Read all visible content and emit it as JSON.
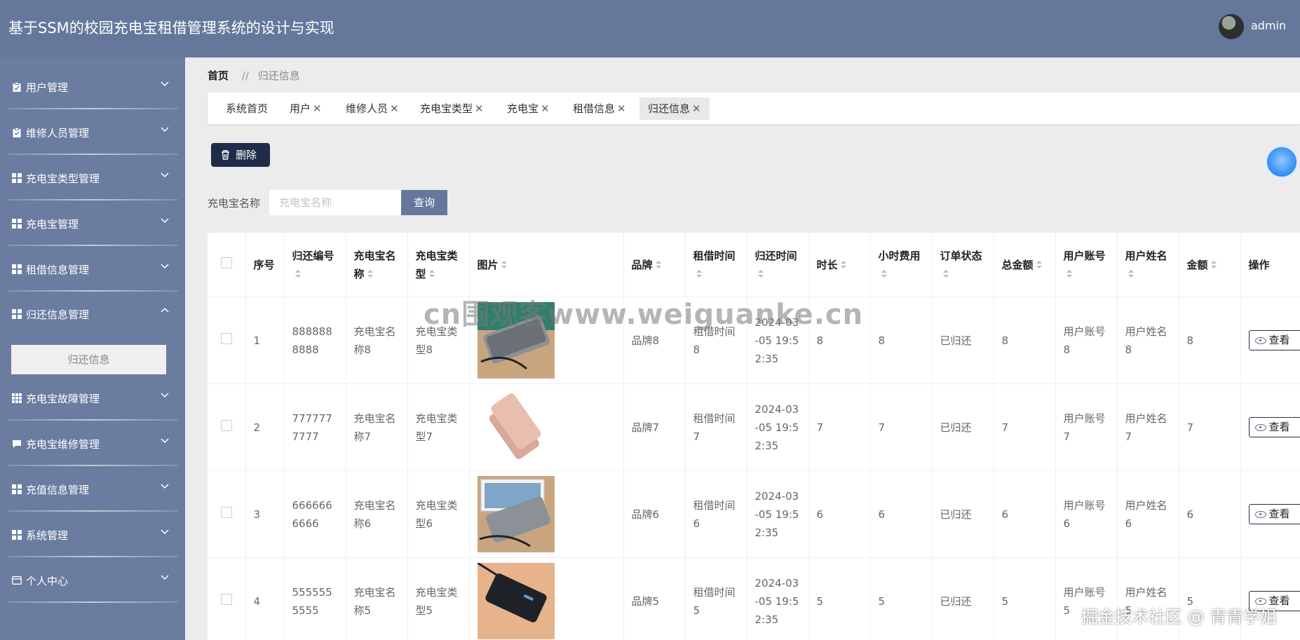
{
  "app": {
    "title": "基于SSM的校园充电宝租借管理系统的设计与实现",
    "username": "admin"
  },
  "sidebar": {
    "items": [
      {
        "label": "用户管理",
        "icon": "clipboard-icon"
      },
      {
        "label": "维修人员管理",
        "icon": "clipboard-check-icon"
      },
      {
        "label": "充电宝类型管理",
        "icon": "grid-icon"
      },
      {
        "label": "充电宝管理",
        "icon": "grid-icon"
      },
      {
        "label": "租借信息管理",
        "icon": "grid-icon"
      },
      {
        "label": "归还信息管理",
        "icon": "grid-icon"
      },
      {
        "label": "充电宝故障管理",
        "icon": "grid-9-icon"
      },
      {
        "label": "充电宝维修管理",
        "icon": "chat-icon"
      },
      {
        "label": "充值信息管理",
        "icon": "grid-icon"
      },
      {
        "label": "系统管理",
        "icon": "grid-icon"
      },
      {
        "label": "个人中心",
        "icon": "card-icon"
      }
    ],
    "sub_item": "归还信息"
  },
  "breadcrumb": {
    "home": "首页",
    "separator": "//",
    "current": "归还信息"
  },
  "tabs": [
    {
      "label": "系统首页",
      "closable": false
    },
    {
      "label": "用户",
      "closable": true
    },
    {
      "label": "维修人员",
      "closable": true
    },
    {
      "label": "充电宝类型",
      "closable": true
    },
    {
      "label": "充电宝",
      "closable": true
    },
    {
      "label": "租借信息",
      "closable": true
    },
    {
      "label": "归还信息",
      "closable": true,
      "active": true
    }
  ],
  "tab_close": "✕",
  "toolbar": {
    "delete_label": "删除"
  },
  "search": {
    "label": "充电宝名称",
    "placeholder": "充电宝名称",
    "value": "",
    "button": "查询"
  },
  "table": {
    "headers": [
      "序号",
      "归还编号",
      "充电宝名称",
      "充电宝类型",
      "图片",
      "品牌",
      "租借时间",
      "归还时间",
      "时长",
      "小时费用",
      "订单状态",
      "总金额",
      "用户账号",
      "用户姓名",
      "金额",
      "操作"
    ],
    "view_label": "查看",
    "rows": [
      {
        "no": "1",
        "code": "8888888888",
        "name": "充电宝名称8",
        "type": "充电宝类型8",
        "image": "silver-powerbank",
        "brand": "品牌8",
        "rent_time": "租借时间8",
        "return_time": "2024-03-05 19:52:35",
        "duration": "8",
        "hourly_fee": "8",
        "status": "已归还",
        "total": "8",
        "account": "用户账号8",
        "user_name": "用户姓名8",
        "amount": "8"
      },
      {
        "no": "2",
        "code": "7777777777",
        "name": "充电宝名称7",
        "type": "充电宝类型7",
        "image": "rose-gold-powerbank",
        "brand": "品牌7",
        "rent_time": "租借时间7",
        "return_time": "2024-03-05 19:52:35",
        "duration": "7",
        "hourly_fee": "7",
        "status": "已归还",
        "total": "7",
        "account": "用户账号7",
        "user_name": "用户姓名7",
        "amount": "7"
      },
      {
        "no": "3",
        "code": "6666666666",
        "name": "充电宝名称6",
        "type": "充电宝类型6",
        "image": "silver-powerbank-tablet",
        "brand": "品牌6",
        "rent_time": "租借时间6",
        "return_time": "2024-03-05 19:52:35",
        "duration": "6",
        "hourly_fee": "6",
        "status": "已归还",
        "total": "6",
        "account": "用户账号6",
        "user_name": "用户姓名6",
        "amount": "6"
      },
      {
        "no": "4",
        "code": "5555555555",
        "name": "充电宝名称5",
        "type": "充电宝类型5",
        "image": "black-powerbank",
        "brand": "品牌5",
        "rent_time": "租借时间5",
        "return_time": "2024-03-05 19:52:35",
        "duration": "5",
        "hourly_fee": "5",
        "status": "已归还",
        "total": "5",
        "account": "用户账号5",
        "user_name": "用户姓名5",
        "amount": "5"
      }
    ]
  },
  "watermarks": {
    "center": "cn围观客www.weiguanke.cn",
    "corner": "掘金技术社区 @ 青青学姐"
  },
  "colors": {
    "header": "#65789c",
    "sidebar": "#6a7ca0",
    "primary_button": "#1f2d4a",
    "query_button": "#65789c"
  }
}
